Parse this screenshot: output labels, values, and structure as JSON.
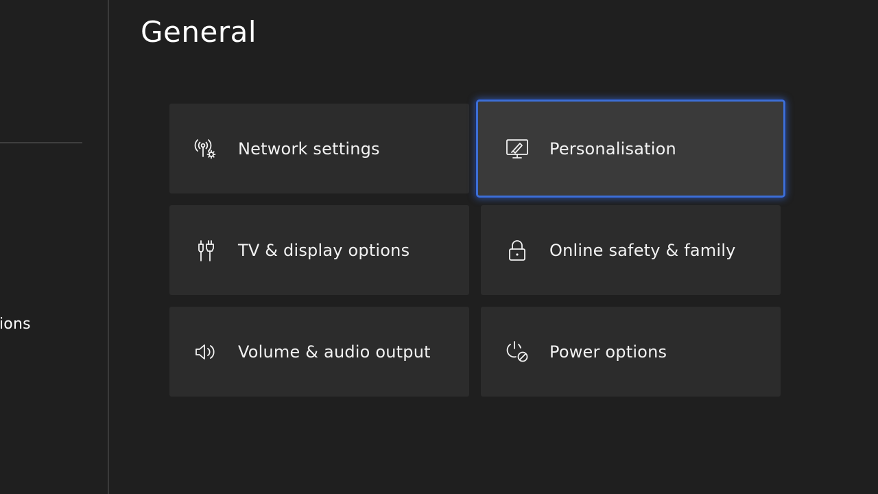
{
  "page": {
    "title": "General"
  },
  "sidebar": {
    "partial_item_label": "ions"
  },
  "tiles": [
    {
      "label": "Network settings",
      "icon": "network-settings-icon",
      "focused": false
    },
    {
      "label": "Personalisation",
      "icon": "personalisation-icon",
      "focused": true
    },
    {
      "label": "TV & display options",
      "icon": "tv-display-icon",
      "focused": false
    },
    {
      "label": "Online safety & family",
      "icon": "lock-icon",
      "focused": false
    },
    {
      "label": "Volume & audio output",
      "icon": "speaker-icon",
      "focused": false
    },
    {
      "label": "Power options",
      "icon": "power-leaf-icon",
      "focused": false
    }
  ],
  "colors": {
    "background": "#1f1f1f",
    "tile": "#2c2c2c",
    "tile_focused": "#3a3a3a",
    "focus_ring": "#3d6fd6",
    "text": "#ffffff"
  }
}
